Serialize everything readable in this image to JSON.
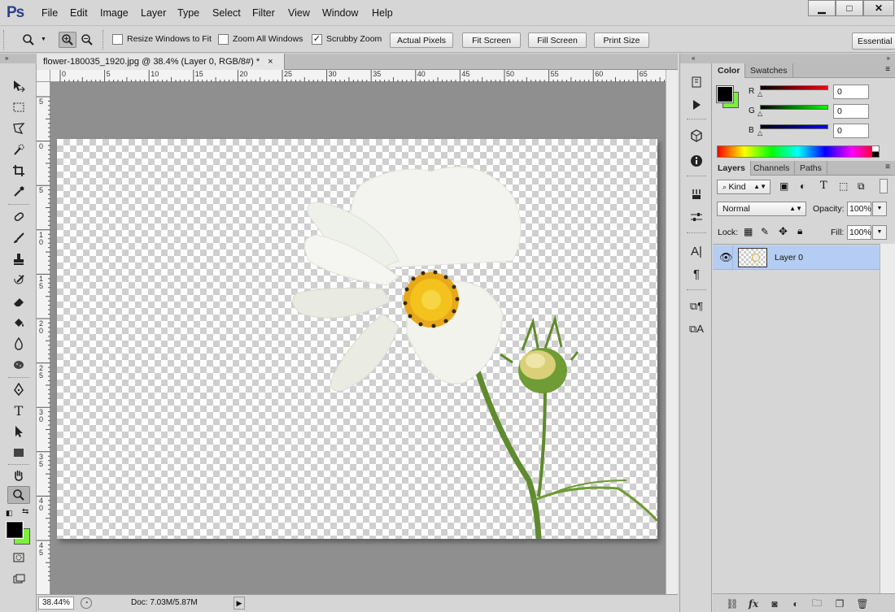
{
  "app": {
    "logo": "Ps"
  },
  "menu": [
    "File",
    "Edit",
    "Image",
    "Layer",
    "Type",
    "Select",
    "Filter",
    "View",
    "Window",
    "Help"
  ],
  "window_controls": {
    "minimize": "▁",
    "maximize": "□",
    "close": "✕"
  },
  "options": {
    "resize_windows_label": "Resize Windows to Fit",
    "resize_windows_checked": false,
    "zoom_all_label": "Zoom All Windows",
    "zoom_all_checked": false,
    "scrubby_label": "Scrubby Zoom",
    "scrubby_checked": true,
    "actual_pixels": "Actual Pixels",
    "fit_screen": "Fit Screen",
    "fill_screen": "Fill Screen",
    "print_size": "Print Size",
    "workspace": "Essential"
  },
  "document": {
    "tab_title": "flower-180035_1920.jpg @ 38.4% (Layer 0, RGB/8#) *",
    "tab_close": "×",
    "ruler_top": [
      "0",
      "5",
      "10",
      "15",
      "20",
      "25",
      "30",
      "35",
      "40",
      "45",
      "50",
      "55",
      "60",
      "65"
    ],
    "ruler_left": [
      "5",
      "0",
      "5",
      "1\n0",
      "1\n5",
      "2\n0",
      "2\n5",
      "3\n0",
      "3\n5",
      "4\n0",
      "4\n5"
    ],
    "zoom": "38.44%",
    "doc_size": "Doc: 7.03M/5.87M"
  },
  "color_panel": {
    "tabs": [
      "Color",
      "Swatches"
    ],
    "r_label": "R",
    "g_label": "G",
    "b_label": "B",
    "r_value": "0",
    "g_value": "0",
    "b_value": "0",
    "foreground": "#000000",
    "background": "#7cf03c"
  },
  "layers_panel": {
    "tabs": [
      "Layers",
      "Channels",
      "Paths"
    ],
    "kind_label": "Kind",
    "blend_mode": "Normal",
    "opacity_label": "Opacity:",
    "opacity_value": "100%",
    "lock_label": "Lock:",
    "fill_label": "Fill:",
    "fill_value": "100%",
    "layers": [
      {
        "name": "Layer 0",
        "visible": true
      }
    ]
  }
}
